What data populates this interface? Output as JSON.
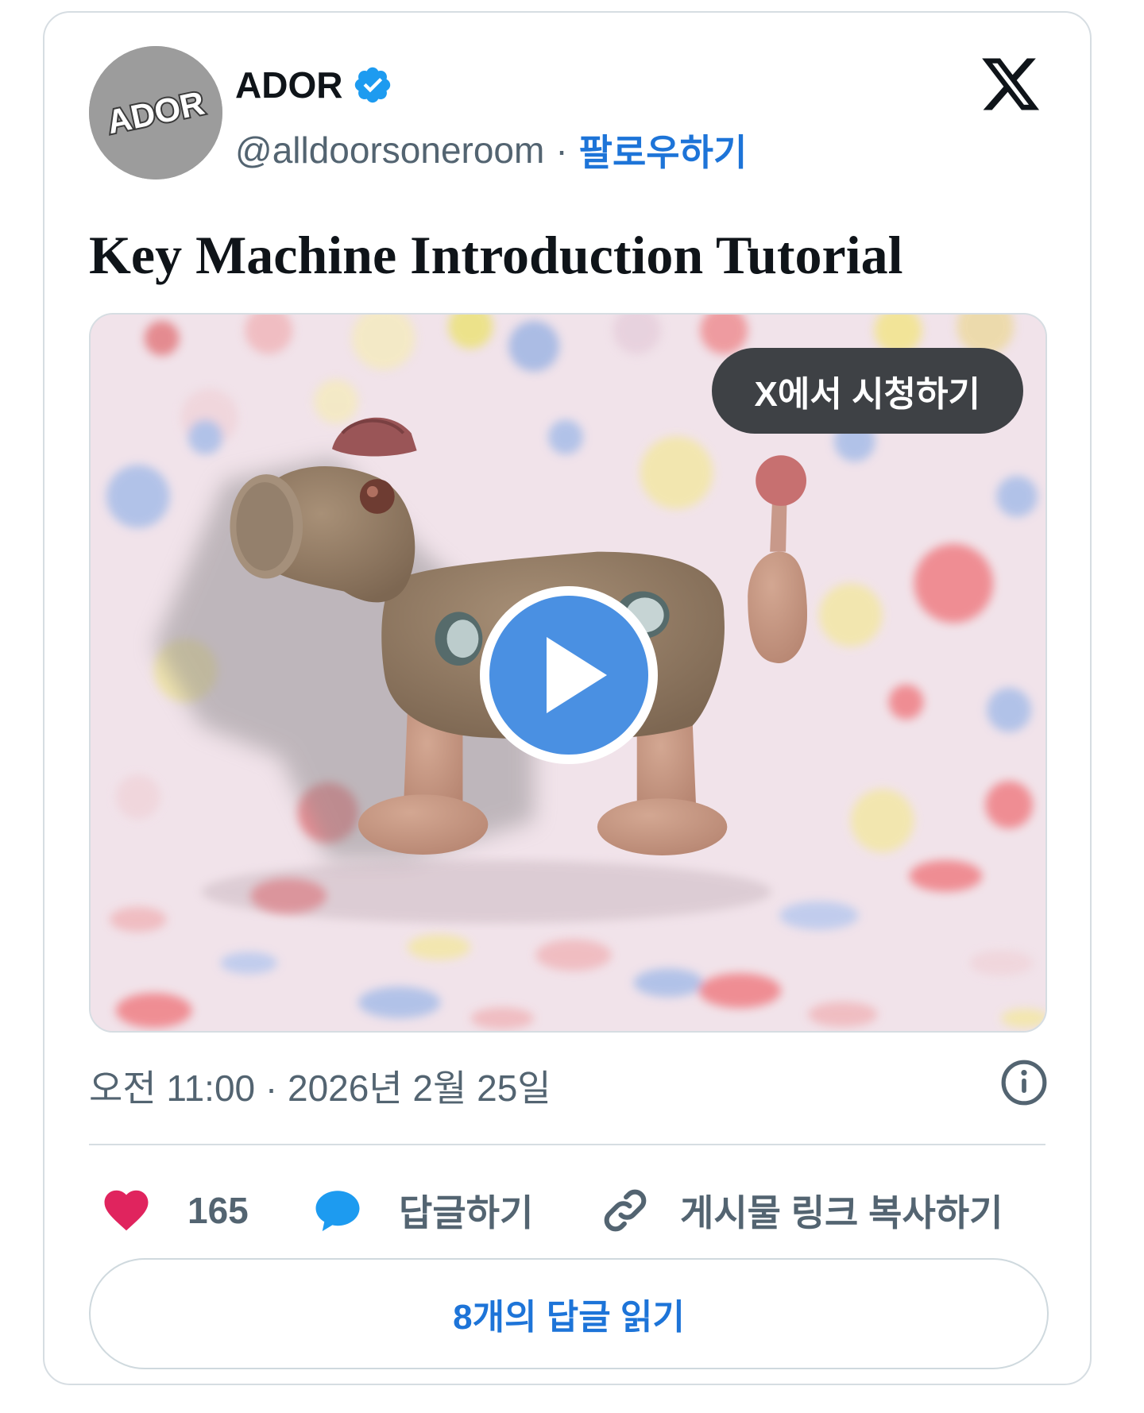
{
  "header": {
    "avatar_text": "ADOR",
    "name": "ADOR",
    "handle": "@alldoorsoneroom",
    "separator": "·",
    "follow_label": "팔로우하기"
  },
  "post": {
    "title": "Key Machine Introduction Tutorial",
    "watch_label": "X에서 시청하기",
    "timestamp": "오전 11:00 · 2026년 2월 25일"
  },
  "actions": {
    "likes_count": "165",
    "reply_label": "답글하기",
    "copy_link_label": "게시물 링크 복사하기"
  },
  "footer": {
    "read_replies_label": "8개의 답글 읽기"
  },
  "colors": {
    "accent": "#1d74d8",
    "heart": "#e0245e",
    "reply": "#1d9bf0",
    "muted": "#536471",
    "play": "#4a90e2"
  }
}
